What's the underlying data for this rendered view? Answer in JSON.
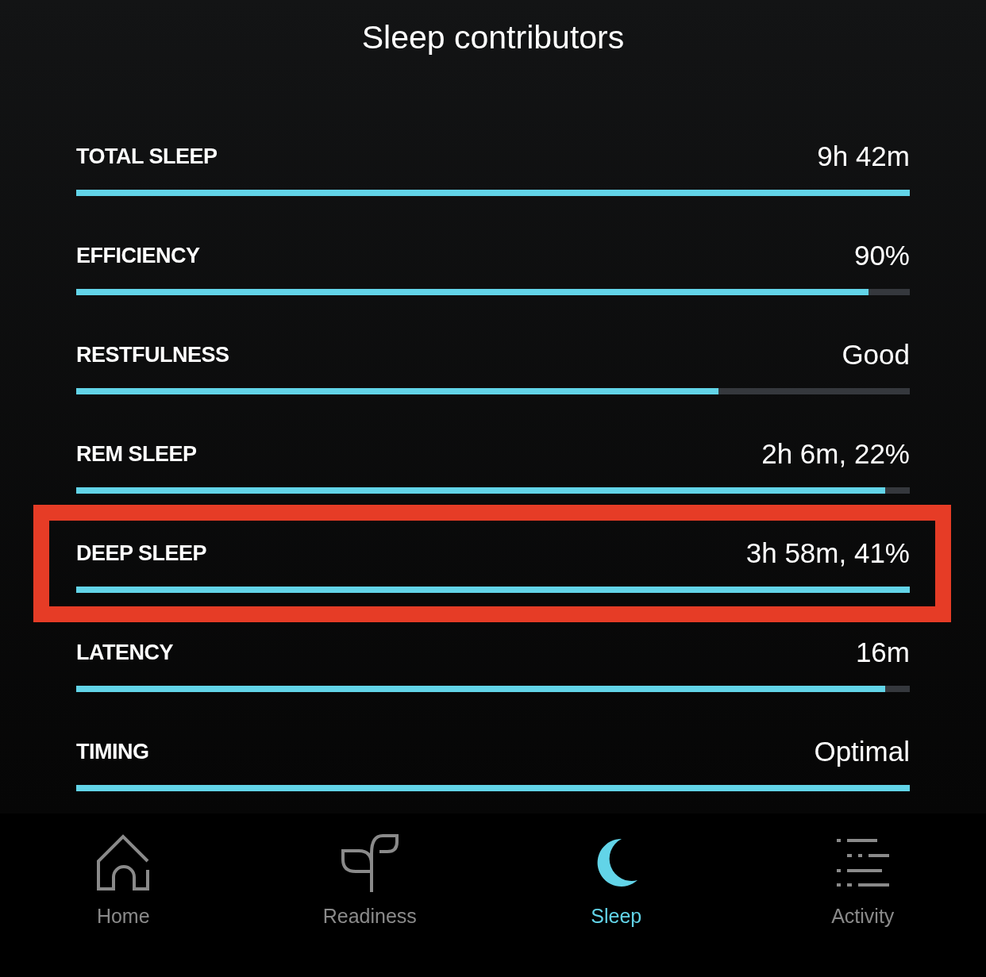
{
  "title": "Sleep contributors",
  "contributors": [
    {
      "label": "TOTAL SLEEP",
      "value": "9h 42m",
      "level": 1,
      "highlighted": false
    },
    {
      "label": "EFFICIENCY",
      "value": "90%",
      "level": 0.95,
      "highlighted": false
    },
    {
      "label": "RESTFULNESS",
      "value": "Good",
      "level": 0.77,
      "highlighted": false
    },
    {
      "label": "REM SLEEP",
      "value": "2h 6m, 22%",
      "level": 0.97,
      "highlighted": false
    },
    {
      "label": "DEEP SLEEP",
      "value": "3h 58m, 41%",
      "level": 1,
      "highlighted": true
    },
    {
      "label": "LATENCY",
      "value": "16m",
      "level": 0.97,
      "highlighted": false
    },
    {
      "label": "TIMING",
      "value": "Optimal",
      "level": 1,
      "highlighted": false
    }
  ],
  "tab_bar": {
    "tabs": [
      {
        "label": "Home",
        "selected": false
      },
      {
        "label": "Readiness",
        "selected": false
      },
      {
        "label": "Sleep",
        "selected": true
      },
      {
        "label": "Activity",
        "selected": false
      }
    ]
  }
}
